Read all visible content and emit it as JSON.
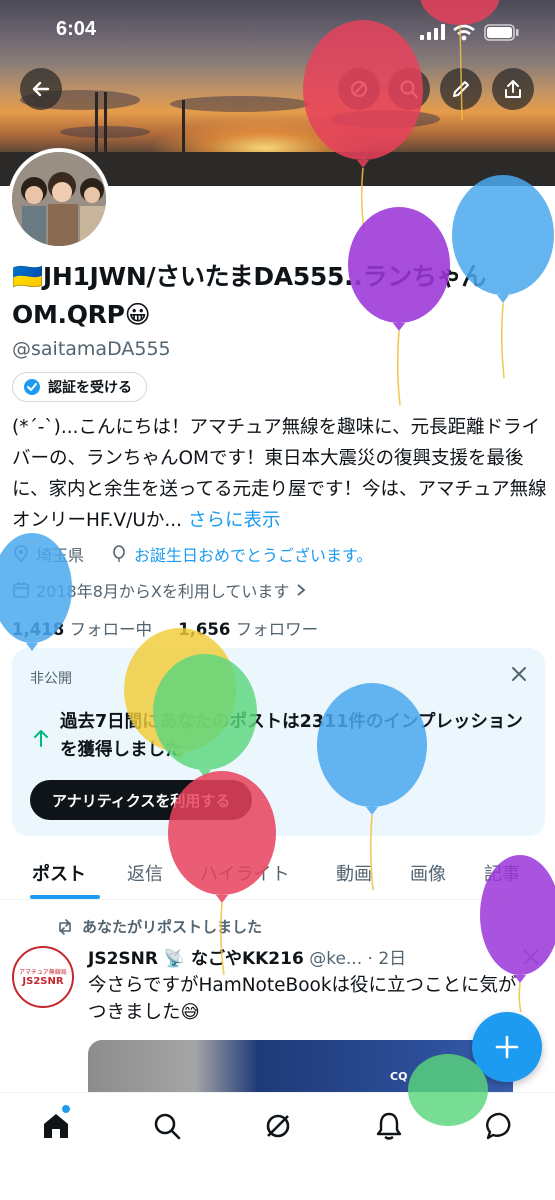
{
  "status_bar": {
    "time": "6:04"
  },
  "profile": {
    "display_name": "JH1JWN/さいたまDA555..ランちゃんOM.QRP",
    "flag_emoji": "🇺🇦",
    "smile_emoji": "😀",
    "handle": "@saitamaDA555",
    "verify_label": "認証を受ける",
    "bio": "(*´-`)...こんにちは！アマチュア無線を趣味に、元長距離ドライバーの、ランちゃんOMです！東日本大震災の復興支援を最後に、家内と余生を送ってる元走り屋です！今は、アマチュア無線オンリーHF.V/Uか...",
    "bio_more": "さらに表示",
    "location": "埼玉県",
    "birthday": "お誕生日おめでとうございます。",
    "joined": "2018年8月からXを利用しています",
    "following_count": "1,418",
    "following_label": "フォロー中",
    "followers_count": "1,656",
    "followers_label": "フォロワー"
  },
  "private_card": {
    "label": "非公開",
    "text": "過去7日間にあなたのポストは2311件のインプレッションを獲得しました",
    "button": "アナリティクスを利用する"
  },
  "tabs": [
    "ポスト",
    "返信",
    "ハイライト",
    "動画",
    "画像",
    "記事"
  ],
  "post": {
    "repost_label": "あなたがリポストしました",
    "author_name": "JS2SNR 📡 なごやKK216",
    "author_handle": "@ke...",
    "time": "2日",
    "text": "今さらですがHamNoteBookは役に立つことに気がつきました😅",
    "avatar_text_top": "アマチュア無線局",
    "avatar_text_main": "JS2SNR",
    "image_text": "CQ"
  },
  "colors": {
    "accent": "#1d9bf0",
    "text_primary": "#0f1419",
    "text_secondary": "#536471",
    "card_bg": "#ecf7fd"
  }
}
